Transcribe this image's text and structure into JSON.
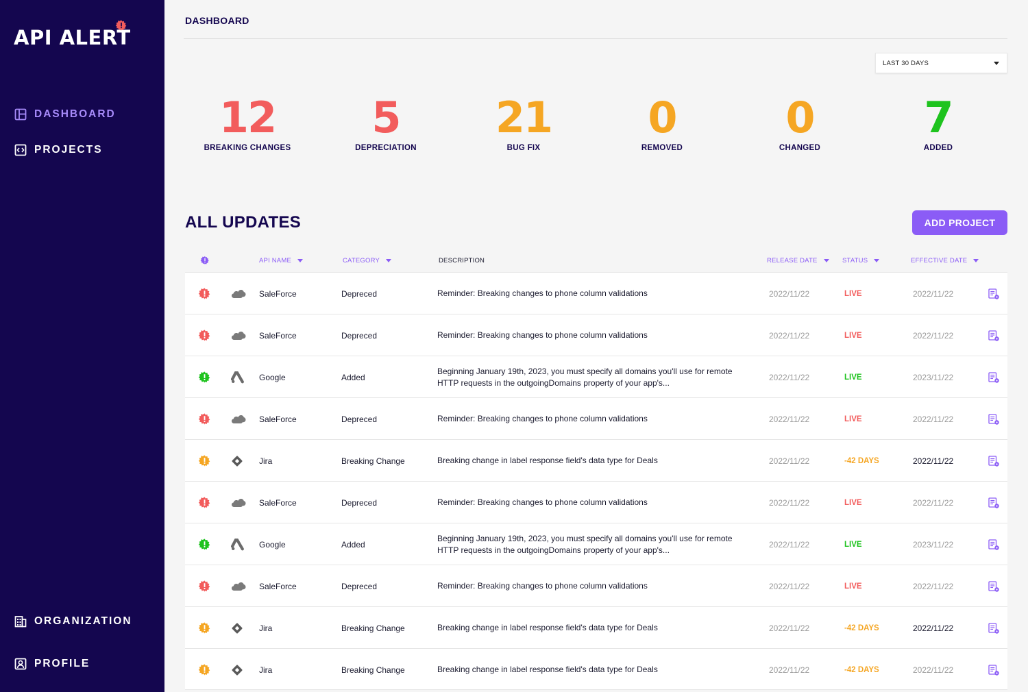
{
  "app": {
    "logo_text": "API ALERT"
  },
  "colors": {
    "sidebar": "#14064f",
    "accent": "#8b5cf6",
    "red": "#f25c5c",
    "orange": "#f5a623",
    "green": "#1ec31e"
  },
  "nav": {
    "dashboard": {
      "label": "DASHBOARD",
      "icon": "layout-icon"
    },
    "projects": {
      "label": "PROJECTS",
      "icon": "code-box-icon"
    },
    "organization": {
      "label": "ORGANIZATION",
      "icon": "building-icon"
    },
    "profile": {
      "label": "PROFILE",
      "icon": "user-box-icon"
    }
  },
  "header": {
    "title": "DASHBOARD"
  },
  "range": {
    "selected": "LAST 30 DAYS"
  },
  "stats": [
    {
      "value": "12",
      "label": "BREAKING CHANGES",
      "color": "#f25c5c"
    },
    {
      "value": "5",
      "label": "DEPRECIATION",
      "color": "#f25c5c"
    },
    {
      "value": "21",
      "label": "BUG FIX",
      "color": "#f5a623"
    },
    {
      "value": "0",
      "label": "REMOVED",
      "color": "#f5a623"
    },
    {
      "value": "0",
      "label": "CHANGED",
      "color": "#f5a623"
    },
    {
      "value": "7",
      "label": "ADDED",
      "color": "#1ec31e"
    }
  ],
  "updates": {
    "title": "ALL UPDATES",
    "add_button": "ADD PROJECT",
    "columns": {
      "api_name": "API NAME",
      "category": "CATEGORY",
      "description": "DESCRIPTION",
      "release_date": "RELEASE DATE",
      "status": "STATUS",
      "effective_date": "EFFECTIVE DATE"
    },
    "rows": [
      {
        "severity": "red",
        "logo": "salesforce-logo-icon",
        "api": "SaleForce",
        "category": "Depreced",
        "description": "Reminder: Breaking changes to phone column validations",
        "release": "2022/11/22",
        "status": "LIVE",
        "status_color": "#f25c5c",
        "effective": "2022/11/22",
        "effective_strong": false
      },
      {
        "severity": "red",
        "logo": "salesforce-logo-icon",
        "api": "SaleForce",
        "category": "Depreced",
        "description": "Reminder: Breaking changes to phone column validations",
        "release": "2022/11/22",
        "status": "LIVE",
        "status_color": "#f25c5c",
        "effective": "2022/11/22",
        "effective_strong": false
      },
      {
        "severity": "green",
        "logo": "google-ads-logo-icon",
        "api": "Google",
        "category": "Added",
        "description": "Beginning January 19th, 2023, you must specify all domains you'll use for remote HTTP requests in the outgoingDomains property of your app's...",
        "release": "2022/11/22",
        "status": "LIVE",
        "status_color": "#1ec31e",
        "effective": "2023/11/22",
        "effective_strong": false
      },
      {
        "severity": "red",
        "logo": "salesforce-logo-icon",
        "api": "SaleForce",
        "category": "Depreced",
        "description": "Reminder: Breaking changes to phone column validations",
        "release": "2022/11/22",
        "status": "LIVE",
        "status_color": "#f25c5c",
        "effective": "2022/11/22",
        "effective_strong": false
      },
      {
        "severity": "orange",
        "logo": "jira-logo-icon",
        "api": "Jira",
        "category": "Breaking Change",
        "description": "Breaking change in label response field's data type for Deals",
        "release": "2022/11/22",
        "status": "-42 DAYS",
        "status_color": "#f5a623",
        "effective": "2022/11/22",
        "effective_strong": true
      },
      {
        "severity": "red",
        "logo": "salesforce-logo-icon",
        "api": "SaleForce",
        "category": "Depreced",
        "description": "Reminder: Breaking changes to phone column validations",
        "release": "2022/11/22",
        "status": "LIVE",
        "status_color": "#f25c5c",
        "effective": "2022/11/22",
        "effective_strong": false
      },
      {
        "severity": "green",
        "logo": "google-ads-logo-icon",
        "api": "Google",
        "category": "Added",
        "description": "Beginning January 19th, 2023, you must specify all domains you'll use for remote HTTP requests in the outgoingDomains property of your app's...",
        "release": "2022/11/22",
        "status": "LIVE",
        "status_color": "#1ec31e",
        "effective": "2023/11/22",
        "effective_strong": false
      },
      {
        "severity": "red",
        "logo": "salesforce-logo-icon",
        "api": "SaleForce",
        "category": "Depreced",
        "description": "Reminder: Breaking changes to phone column validations",
        "release": "2022/11/22",
        "status": "LIVE",
        "status_color": "#f25c5c",
        "effective": "2022/11/22",
        "effective_strong": false
      },
      {
        "severity": "orange",
        "logo": "jira-logo-icon",
        "api": "Jira",
        "category": "Breaking Change",
        "description": "Breaking change in label response field's data type for Deals",
        "release": "2022/11/22",
        "status": "-42 DAYS",
        "status_color": "#f5a623",
        "effective": "2022/11/22",
        "effective_strong": true
      },
      {
        "severity": "orange",
        "logo": "jira-logo-icon",
        "api": "Jira",
        "category": "Breaking Change",
        "description": "Breaking change in label response field's data type for Deals",
        "release": "2022/11/22",
        "status": "-42 DAYS",
        "status_color": "#f5a623",
        "effective": "2022/11/22",
        "effective_strong": false
      }
    ]
  }
}
